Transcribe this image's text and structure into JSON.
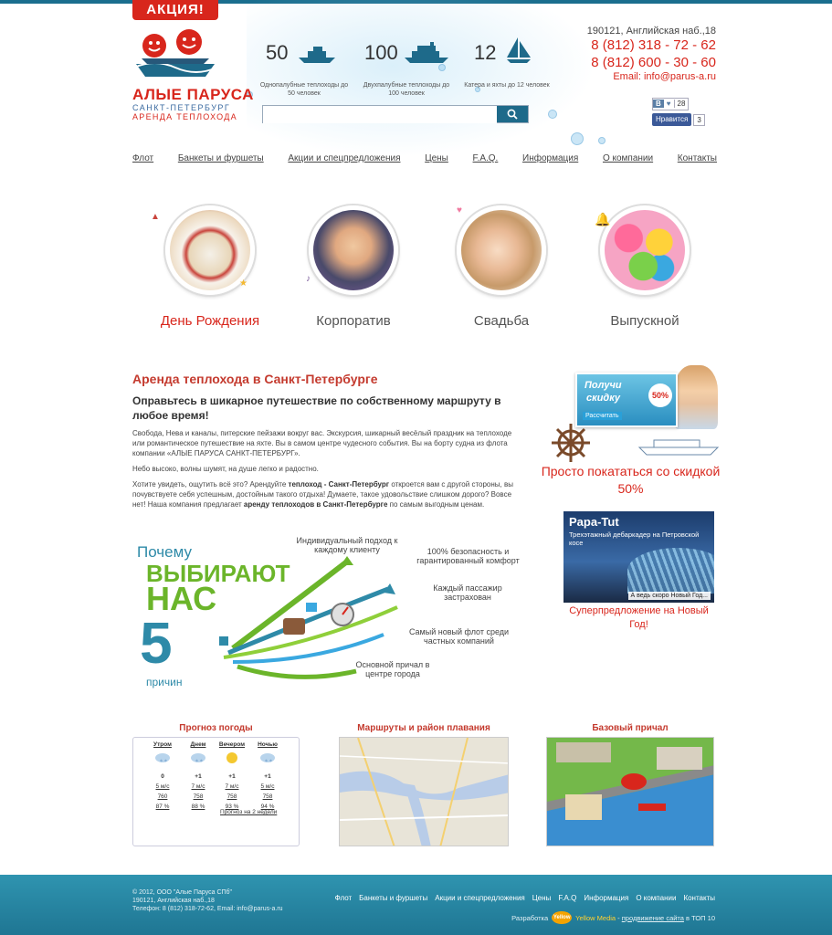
{
  "promo": {
    "label": "АКЦИЯ!"
  },
  "logo": {
    "title": "АЛЫЕ ПАРУСА",
    "city": "САНКТ-ПЕТЕРБУРГ",
    "tagline": "АРЕНДА ТЕПЛОХОДА"
  },
  "stats": [
    {
      "number": "50",
      "caption": "Однопалубные теплоходы до 50 человек"
    },
    {
      "number": "100",
      "caption": "Двухпалубные теплоходы до 100 человек"
    },
    {
      "number": "12",
      "caption": "Катера и яхты до 12 человек"
    }
  ],
  "search": {
    "placeholder": ""
  },
  "contacts": {
    "address": "190121, Английская наб.,18",
    "phone1": "8 (812) 318 - 72 - 62",
    "phone2": "8 (812) 600 - 30 - 60",
    "email": "Email: info@parus-a.ru"
  },
  "social": {
    "vk_label": "В",
    "vk_count": "28",
    "fb_label": "Нравится",
    "fb_count": "3"
  },
  "nav": [
    "Флот",
    "Банкеты и фуршеты",
    "Акции и спецпредложения",
    "Цены",
    "F.A.Q.",
    "Информация",
    "О компании",
    "Контакты"
  ],
  "categories": [
    {
      "label": "День Рождения",
      "active": true
    },
    {
      "label": "Корпоратив",
      "active": false
    },
    {
      "label": "Свадьба",
      "active": false
    },
    {
      "label": "Выпускной",
      "active": false
    }
  ],
  "article": {
    "title": "Аренда теплохода в Санкт-Петербурге",
    "subtitle": "Оправьтесь в шикарное путешествие по собственному маршруту в любое время!",
    "p1": "Свобода, Нева и каналы, питерские пейзажи вокруг вас. Экскурсия, шикарный весёлый праздник на теплоходе или романтическое путешествие на яхте. Вы в самом центре чудесного события. Вы на борту судна из флота компании «АЛЫЕ ПАРУСА САНКТ-ПЕТЕРБУРГ».",
    "p2": "Небо высоко, волны шумят, на душе легко и радостно.",
    "p3_a": "Хотите увидеть, ощутить всё это? Арендуйте ",
    "p3_b": "теплоход - Санкт-Петербург",
    "p3_c": " откроется вам с другой стороны, вы почувствуете себя успешным, достойным такого отдыха! Думаете, такое удовольствие слишком дорого? Вовсе нет! Наша компания предлагает ",
    "p3_d": "аренду теплоходов в Санкт-Петербурге",
    "p3_e": " по самым выгодным ценам."
  },
  "why": {
    "line1": "Почему",
    "line2": "ВЫБИРАЮТ",
    "line3": "НАС",
    "number": "5",
    "line4": "причин",
    "reasons": [
      "Индивидуальный подход к каждому клиенту",
      "100% безопасность и гарантированный комфорт",
      "Каждый пассажир застрахован",
      "Самый новый флот среди частных компаний",
      "Основной причал в центре города"
    ]
  },
  "banner_discount": {
    "line1": "Получи",
    "line2": "скидку",
    "badge": "50%",
    "button": "Рассчитать",
    "caption": "Просто покататься со скидкой 50%"
  },
  "banner_papatut": {
    "title": "Papa-Tut",
    "sub": "Трехэтажный дебаркадер на Петровской косе",
    "foot": "А ведь скоро Новый Год...",
    "caption": "Суперпредложение на Новый Год!"
  },
  "weather": {
    "title": "Прогноз погоды",
    "columns": [
      {
        "period": "Утром",
        "temp": "0",
        "wind": "5 м/с",
        "pressure": "760",
        "humidity": "87 %",
        "icon": "snow-cloud-icon"
      },
      {
        "period": "Днем",
        "temp": "+1",
        "wind": "7 м/с",
        "pressure": "758",
        "humidity": "88 %",
        "icon": "snow-cloud-icon"
      },
      {
        "period": "Вечером",
        "temp": "+1",
        "wind": "7 м/с",
        "pressure": "758",
        "humidity": "93 %",
        "icon": "sun-icon"
      },
      {
        "period": "Ночью",
        "temp": "+1",
        "wind": "5 м/с",
        "pressure": "758",
        "humidity": "94 %",
        "icon": "snow-cloud-icon"
      }
    ],
    "link": "Прогноз на 2 недели"
  },
  "routes": {
    "title": "Маршруты и район плавания"
  },
  "pier": {
    "title": "Базовый причал"
  },
  "footer": {
    "copyright": "© 2012, ООО \"Алые Паруса СПб\"",
    "address": "190121, Английская наб.,18",
    "contact": "Телефон: 8 (812) 318-72-62, Email: info@parus-a.ru",
    "nav": [
      "Флот",
      "Банкеты и фуршеты",
      "Акции и спецпредложения",
      "Цены",
      "F.A.Q",
      "Информация",
      "О компании",
      "Контакты"
    ],
    "dev_label": "Разработка",
    "dev_logo": "Yellow",
    "dev_name": "Yellow Media",
    "dev_dash": " - ",
    "dev_link": "продвижение сайта",
    "dev_suffix": " в ТОП 10"
  },
  "colors": {
    "accent_red": "#d8261c",
    "brand_blue": "#1f7693",
    "green": "#6bb52a"
  }
}
